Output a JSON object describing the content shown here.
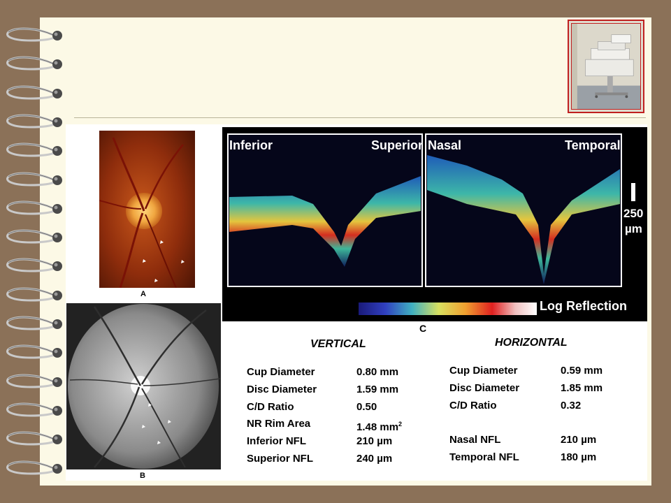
{
  "figure": {
    "label_a": "A",
    "label_b": "B",
    "label_c": "C",
    "oct": {
      "left_scan": {
        "left_label": "Inferior",
        "right_label": "Superior"
      },
      "right_scan": {
        "left_label": "Nasal",
        "right_label": "Temporal"
      },
      "scale_bar": {
        "value": "250",
        "unit": "µm"
      },
      "colorbar_label": "Log Reflection"
    },
    "vertical": {
      "title": "VERTICAL",
      "rows": [
        {
          "name": "Cup Diameter",
          "value": "0.80 mm"
        },
        {
          "name": "Disc Diameter",
          "value": "1.59 mm"
        },
        {
          "name": "C/D Ratio",
          "value": "0.50"
        },
        {
          "name": "NR Rim Area",
          "value": "1.48 mm",
          "sup": "2"
        },
        {
          "name": "Inferior NFL",
          "value": "210 µm"
        },
        {
          "name": "Superior NFL",
          "value": "240 µm"
        }
      ]
    },
    "horizontal": {
      "title": "HORIZONTAL",
      "rows": [
        {
          "name": "Cup Diameter",
          "value": "0.59 mm"
        },
        {
          "name": "Disc Diameter",
          "value": "1.85 mm"
        },
        {
          "name": "C/D Ratio",
          "value": "0.32"
        },
        {
          "name": "",
          "value": ""
        },
        {
          "name": "Nasal NFL",
          "value": "210 µm"
        },
        {
          "name": "Temporal NFL",
          "value": "180 µm"
        }
      ]
    }
  },
  "colors": {
    "background": "#8b7158",
    "page": "#fcf9e6",
    "thumb_border": "#c02020"
  }
}
